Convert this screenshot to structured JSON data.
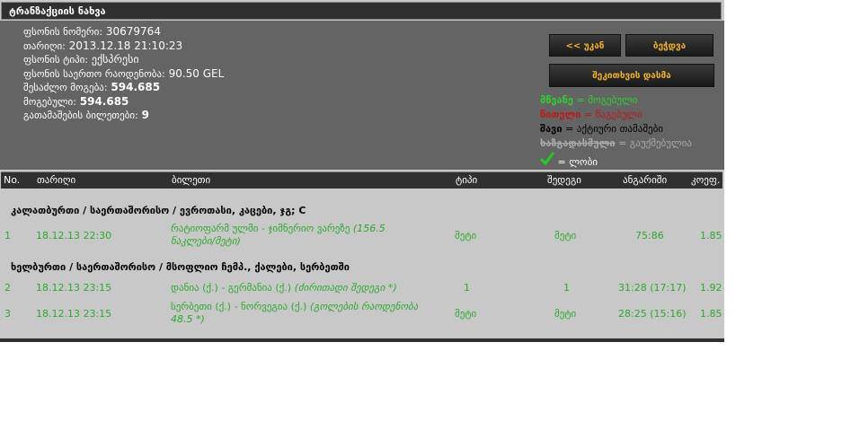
{
  "title": "ტრანზაქციის ნახვა",
  "info": {
    "fields": [
      {
        "label": "ფსონის ნომერი:",
        "value": "30679764",
        "bold": false
      },
      {
        "label": "თარიღი:",
        "value": "2013.12.18 21:10:23",
        "bold": false
      },
      {
        "label": "ფსონის ტიპი:",
        "value": "ექსპრესი",
        "bold": false
      },
      {
        "label": "ფსონის საერთო რაოდენობა:",
        "value": "90.50 GEL",
        "bold": false
      },
      {
        "label": "შესაძლო მოგება:",
        "value": "594.685",
        "bold": true
      },
      {
        "label": "მოგებული:",
        "value": "594.685",
        "bold": true
      },
      {
        "label": "გათამაშების ბილეთები:",
        "value": "9",
        "bold": true
      }
    ]
  },
  "buttons": {
    "back": "<< უკან",
    "print": "ბეჭდვა",
    "result": "შეკითხვის დასმა"
  },
  "legend": {
    "green": {
      "key": "მწვანე",
      "sep": " = ",
      "val": "მოგებული"
    },
    "red": {
      "key": "წითელი",
      "sep": " = ",
      "val": "წაგებული"
    },
    "black": {
      "key": "შავი",
      "sep": " = ",
      "val": "აქტიური თამაშები"
    },
    "gray": {
      "key": "ხაზგადასმული",
      "sep": " = ",
      "val": "გაუქმებულია"
    },
    "check": {
      "sep": " = ",
      "val": "ლობი"
    }
  },
  "colors": {
    "green": "#2ea82e",
    "red": "#c01818",
    "accent": "#f0b030",
    "header": "#303030"
  },
  "table": {
    "headers": [
      "No.",
      "თარიღი",
      "ბილეთი",
      "ტიპი",
      "შედეგი",
      "ანგარიში",
      "კოეფ."
    ],
    "groups": [
      {
        "title": "კალათბურთი / საერთაშორისო / ევროთასი, კაცები, ჯგ; C",
        "rows": [
          {
            "no": "1",
            "date": "18.12.13 22:30",
            "event": "რატიოფარმ ულმი - ჯიმნერიო ვარეზე",
            "event_extra": "(156.5 ნაკლები/მეტი)",
            "type": "მეტი",
            "result": "მეტი",
            "score": "75:86",
            "odds": "1.85"
          }
        ]
      },
      {
        "title": "ხელბურთი / საერთაშორისო / მსოფლიო ჩემპ., ქალები, სერბეთში",
        "rows": [
          {
            "no": "2",
            "date": "18.12.13 23:15",
            "event": "დანია (ქ.) - გერმანია (ქ.)",
            "event_extra": "(ძირითადი შედეგი *)",
            "type": "1",
            "result": "1",
            "score": "31:28 (17:17)",
            "odds": "1.92"
          },
          {
            "no": "3",
            "date": "18.12.13 23:15",
            "event": "სერბეთი (ქ.) - ნორვეგია (ქ.)",
            "event_extra": "(გოლების რაოდენობა 48.5 *)",
            "type": "მეტი",
            "result": "მეტი",
            "score": "28:25 (15:16)",
            "odds": "1.85"
          }
        ]
      }
    ]
  }
}
